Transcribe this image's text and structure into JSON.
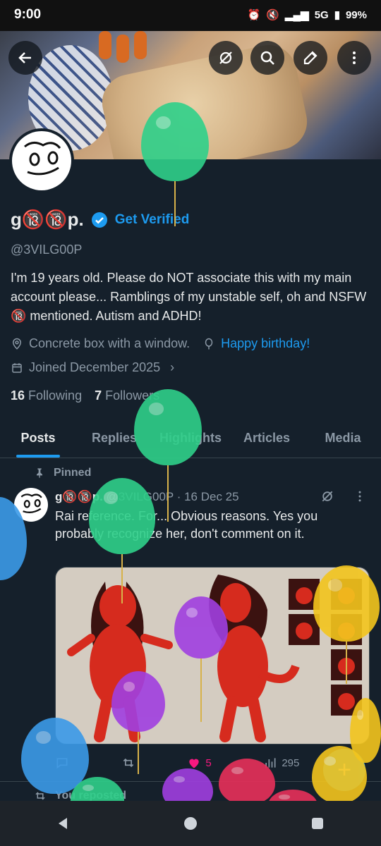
{
  "status_bar": {
    "time": "9:00",
    "network": "5G",
    "battery": "99%"
  },
  "profile": {
    "display_name": "g🔞🔞p.",
    "verify_label": "Get Verified",
    "handle": "@3VILG00P",
    "bio": "I'm 19 years old.  Please do NOT associate this with my main account please... Ramblings of my unstable self, oh and NSFW 🔞 mentioned. Autism and ADHD!",
    "location": "Concrete box with a window.",
    "website": "Happy birthday!",
    "joined": "Joined December 2025",
    "following_count": "16",
    "following_label": "Following",
    "followers_count": "7",
    "followers_label": "Followers"
  },
  "tabs": [
    {
      "label": "Posts",
      "active": true
    },
    {
      "label": "Replies",
      "active": false
    },
    {
      "label": "Highlights",
      "active": false
    },
    {
      "label": "Articles",
      "active": false
    },
    {
      "label": "Media",
      "active": false
    }
  ],
  "pinned_post": {
    "pinned_label": "Pinned",
    "author_name": "g🔞🔞p.",
    "author_handle": "@3VILG00P",
    "date": "· 16 Dec 25",
    "text": "Rai reference. For... Obvious reasons. Yes you probably recognize her, don't comment on it.",
    "likes": "5",
    "views": "295"
  },
  "next_post": {
    "reposted_label": "You reposted"
  },
  "colors": {
    "accent": "#1d9bf0",
    "background": "#15202b",
    "like": "#f91880"
  },
  "icons": [
    "back-arrow-icon",
    "grok-icon",
    "search-icon",
    "edit-icon",
    "more-vertical-icon",
    "location-icon",
    "balloon-icon",
    "calendar-icon",
    "pin-icon",
    "retweet-icon",
    "heart-icon",
    "views-icon",
    "reply-icon"
  ]
}
